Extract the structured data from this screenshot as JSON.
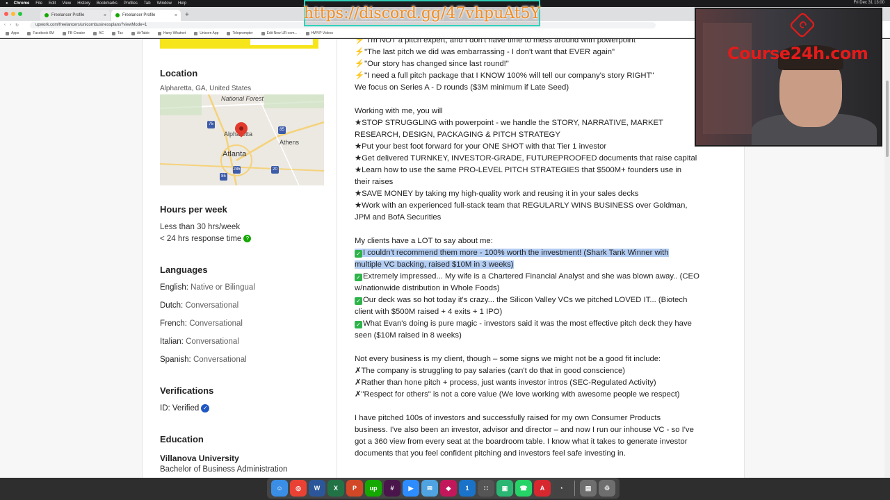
{
  "menubar": {
    "items": [
      "Chrome",
      "File",
      "Edit",
      "View",
      "History",
      "Bookmarks",
      "Profiles",
      "Tab",
      "Window",
      "Help"
    ],
    "clock": "Fri Dec 31 13:00"
  },
  "browser": {
    "tabs": [
      {
        "title": "Freelancer Profile",
        "active": false
      },
      {
        "title": "Freelancer Profile",
        "active": true
      }
    ],
    "url": "upwork.com/freelancers/unicornbusinessplans?viewMode=1",
    "bookmarks": [
      "Apps",
      "Facebook 6M",
      "FB Creator",
      "AC",
      "Tax",
      "AirTable",
      "Harry Whatnet",
      "Unicorn App",
      "Teleprompter",
      "Edit New UR-com...",
      "HWVP Videos"
    ]
  },
  "overlay": {
    "discord_url": "https://discord.gg/47vhpuAt5Y",
    "watermark": "Course24h.com"
  },
  "profile": {
    "location": {
      "heading": "Location",
      "value": "Alpharetta, GA, United States"
    },
    "map": {
      "labels": [
        "National Forest",
        "Alpharetta",
        "Athens",
        "Atlanta"
      ],
      "highways": [
        "75",
        "85",
        "285",
        "20",
        "85"
      ]
    },
    "hours": {
      "heading": "Hours per week",
      "value": "Less than 30 hrs/week",
      "response": "< 24 hrs response time",
      "response_icon": "?"
    },
    "languages": {
      "heading": "Languages",
      "items": [
        {
          "name": "English:",
          "level": "Native or Bilingual"
        },
        {
          "name": "Dutch:",
          "level": "Conversational"
        },
        {
          "name": "French:",
          "level": "Conversational"
        },
        {
          "name": "Italian:",
          "level": "Conversational"
        },
        {
          "name": "Spanish:",
          "level": "Conversational"
        }
      ]
    },
    "verifications": {
      "heading": "Verifications",
      "value": "ID: Verified"
    },
    "education": {
      "heading": "Education",
      "school": "Villanova University",
      "degree": "Bachelor of Business Administration"
    }
  },
  "description": {
    "quotes": [
      "\"I'm NOT a pitch expert, and I don't have time to mess around with powerpoint\"",
      "\"The last pitch we did was embarrassing - I don't want that EVER again\"",
      "\"Our story has changed since last round!\"",
      "\"I need a full pitch package that I KNOW 100% will tell our company's story RIGHT\""
    ],
    "focus": "We focus on Series A - D rounds ($3M minimum if Late Seed)",
    "working_intro": "Working with me, you will",
    "benefits": [
      "★STOP STRUGGLING with powerpoint - we handle the STORY, NARRATIVE, MARKET",
      "RESEARCH, DESIGN, PACKAGING & PITCH STRATEGY",
      "★Put your best foot forward for your ONE SHOT with that Tier 1 investor",
      "★Get delivered TURNKEY, INVESTOR-GRADE, FUTUREPROOFED documents that raise capital",
      "★Learn how to use the same PRO-LEVEL PITCH STRATEGIES that $500M+ founders use in",
      "their raises",
      "★SAVE MONEY by taking my high-quality work and reusing it in your sales decks",
      "★Work with an experienced full-stack team that REGULARLY WINS BUSINESS over Goldman,",
      "JPM and BofA Securities"
    ],
    "clients_intro": "My clients have a LOT to say about me:",
    "testimonial_highlighted": [
      "I couldn't recommend them more - 100% worth the investment! (Shark Tank Winner with",
      "multiple VC backing, raised $10M in 3 weeks)"
    ],
    "testimonials": [
      "Extremely impressed... My wife is a Chartered Financial Analyst and she was blown away.. (CEO",
      "w/nationwide distribution in Whole Foods)",
      "Our deck was so hot today it's crazy... the Silicon Valley VCs we pitched LOVED IT... (Biotech",
      "client with $500M raised + 4 exits + 1 IPO)",
      "What Evan's doing is pure magic - investors said it was the most effective pitch deck they have",
      "seen ($10M raised in 8 weeks)"
    ],
    "notfit_intro": "Not every business is my client, though – some signs we might not be a good fit include:",
    "notfit": [
      "✗The company is struggling to pay salaries (can't do that in good conscience)",
      "✗Rather than hone pitch + process, just wants investor intros (SEC-Regulated Activity)",
      "✗\"Respect for others\" is not a core value (We love working with awesome people we respect)"
    ],
    "bio": [
      "I have pitched 100s of investors and successfully raised for my own Consumer Products",
      "business. I've also been an investor, advisor and director – and now I run our inhouse VC - so I've",
      "got a 360 view from every seat at the boardroom table. I know what it takes to generate investor",
      "documents that you feel confident pitching and investors feel safe investing in."
    ]
  },
  "dock": {
    "apps": [
      {
        "name": "finder",
        "color": "#3a8ee6",
        "glyph": "☺"
      },
      {
        "name": "chrome",
        "color": "#e94235",
        "glyph": "◎"
      },
      {
        "name": "word",
        "color": "#2b579a",
        "glyph": "W"
      },
      {
        "name": "excel",
        "color": "#217346",
        "glyph": "X"
      },
      {
        "name": "powerpoint",
        "color": "#d24726",
        "glyph": "P"
      },
      {
        "name": "upwork",
        "color": "#14a800",
        "glyph": "up"
      },
      {
        "name": "slack",
        "color": "#4a154b",
        "glyph": "#"
      },
      {
        "name": "zoom",
        "color": "#2d8cff",
        "glyph": "▶"
      },
      {
        "name": "mail",
        "color": "#4fa3e0",
        "glyph": "✉"
      },
      {
        "name": "app-red",
        "color": "#c2185b",
        "glyph": "◆"
      },
      {
        "name": "1password",
        "color": "#1a73c8",
        "glyph": "1"
      },
      {
        "name": "calculator",
        "color": "#555555",
        "glyph": "∷"
      },
      {
        "name": "app-green",
        "color": "#2bb673",
        "glyph": "▣"
      },
      {
        "name": "whatsapp",
        "color": "#25d366",
        "glyph": "☎"
      },
      {
        "name": "acrobat",
        "color": "#d7282f",
        "glyph": "A"
      },
      {
        "name": "activity-monitor",
        "color": "#444444",
        "glyph": "◔"
      }
    ],
    "trailing": [
      {
        "name": "folder",
        "color": "#6e6e6e",
        "glyph": "▤"
      },
      {
        "name": "trash",
        "color": "#6e6e6e",
        "glyph": "♲"
      }
    ]
  }
}
